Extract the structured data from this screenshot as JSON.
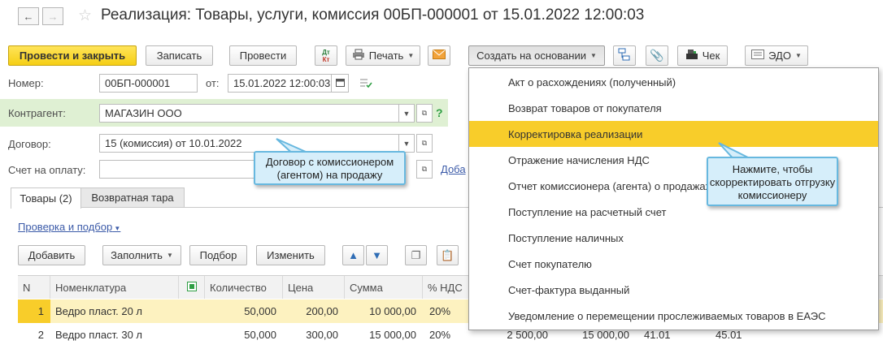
{
  "window": {
    "title": "Реализация: Товары, услуги, комиссия 00БП-000001 от 15.01.2022 12:00:03",
    "back_icon": "arrow-left-icon",
    "forward_icon": "arrow-right-icon",
    "favorite_icon": "star-icon"
  },
  "toolbar": {
    "post_close": "Провести и закрыть",
    "save": "Записать",
    "post": "Провести",
    "dt_kt_top": "Дт",
    "dt_kt_bottom": "Кт",
    "print": "Печать",
    "create_based": "Создать на основании",
    "receipt": "Чек",
    "edo": "ЭДО"
  },
  "form": {
    "number_label": "Номер:",
    "number_value": "00БП-000001",
    "date_label": "от:",
    "date_value": "15.01.2022 12:00:03",
    "counterparty_label": "Контрагент:",
    "counterparty_value": "МАГАЗИН ООО",
    "help_mark": "?",
    "contract_label": "Договор:",
    "contract_value": "15 (комиссия) от 10.01.2022",
    "invoice_label": "Счет на оплату:",
    "invoice_value": "",
    "add_link": "Доба"
  },
  "tabs": [
    {
      "label": "Товары (2)"
    },
    {
      "label": "Возвратная тара"
    }
  ],
  "table_toolbar": {
    "check_link": "Проверка и подбор",
    "add": "Добавить",
    "fill": "Заполнить",
    "pick": "Подбор",
    "edit": "Изменить"
  },
  "table": {
    "headers": [
      "N",
      "Номенклатура",
      "",
      "Количество",
      "Цена",
      "Сумма",
      "% НДС"
    ],
    "rows": [
      {
        "n": "1",
        "item": "Ведро пласт. 20 л",
        "qty": "50,000",
        "price": "200,00",
        "sum": "10 000,00",
        "vat": "20%",
        "tail": [
          "",
          "",
          "",
          ""
        ]
      },
      {
        "n": "2",
        "item": "Ведро пласт. 30 л",
        "qty": "50,000",
        "price": "300,00",
        "sum": "15 000,00",
        "vat": "20%",
        "tail": [
          "2 500,00",
          "15 000,00",
          "41.01",
          "45.01"
        ]
      }
    ]
  },
  "menu": {
    "items": [
      {
        "label": "Акт о расхождениях (полученный)"
      },
      {
        "label": "Возврат товаров от покупателя"
      },
      {
        "label": "Корректировка реализации"
      },
      {
        "label": "Отражение начисления НДС"
      },
      {
        "label": "Отчет комиссионера (агента) о продажах"
      },
      {
        "label": "Поступление на расчетный счет"
      },
      {
        "label": "Поступление наличных"
      },
      {
        "label": "Счет покупателю"
      },
      {
        "label": "Счет-фактура выданный"
      },
      {
        "label": "Уведомление о перемещении прослеживаемых товаров в ЕАЭС"
      }
    ],
    "highlight_color": "#f8cd2a"
  },
  "callouts": {
    "contract_note": "Договор с комиссионером (агентом) на продажу",
    "menu_note": "Нажмите, чтобы скорректировать отгрузку комиссионеру"
  },
  "colors": {
    "primary_button": "#f5cf14",
    "selected_row": "#fdf2c0",
    "counterparty_bg": "#dff0d3",
    "callout_bg": "#d6eefa",
    "callout_border": "#67b8df"
  }
}
